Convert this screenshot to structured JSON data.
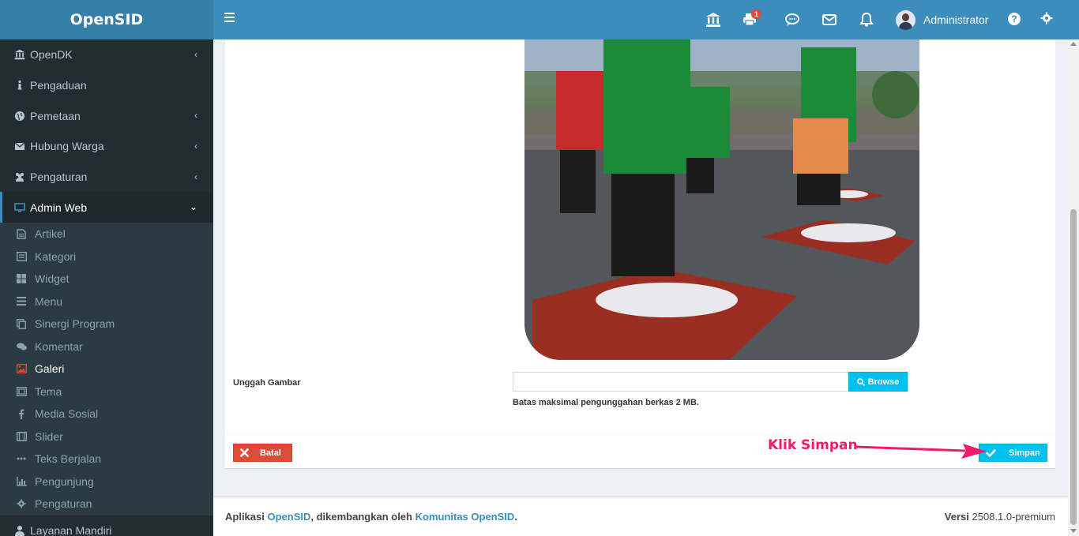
{
  "app": {
    "title": "OpenSID"
  },
  "header": {
    "username": "Administrator",
    "print_badge": "1"
  },
  "sidebar": {
    "items": [
      {
        "label": "OpenDK",
        "icon": "bank-icon",
        "has_children": true
      },
      {
        "label": "Pengaduan",
        "icon": "info-icon",
        "has_children": false
      },
      {
        "label": "Pemetaan",
        "icon": "globe-icon",
        "has_children": true
      },
      {
        "label": "Hubung Warga",
        "icon": "envelope-icon",
        "has_children": true
      },
      {
        "label": "Pengaturan",
        "icon": "users-icon",
        "has_children": true
      },
      {
        "label": "Admin Web",
        "icon": "desktop-icon",
        "has_children": true,
        "expanded": true
      }
    ],
    "submenu": [
      {
        "label": "Artikel",
        "icon": "file-icon"
      },
      {
        "label": "Kategori",
        "icon": "list-alt-icon"
      },
      {
        "label": "Widget",
        "icon": "windows-icon"
      },
      {
        "label": "Menu",
        "icon": "bars-icon"
      },
      {
        "label": "Sinergi Program",
        "icon": "copy-icon"
      },
      {
        "label": "Komentar",
        "icon": "comments-icon"
      },
      {
        "label": "Galeri",
        "icon": "image-icon",
        "active": true
      },
      {
        "label": "Tema",
        "icon": "image-frame-icon"
      },
      {
        "label": "Media Sosial",
        "icon": "facebook-icon"
      },
      {
        "label": "Slider",
        "icon": "film-icon"
      },
      {
        "label": "Teks Berjalan",
        "icon": "ellipsis-icon"
      },
      {
        "label": "Pengunjung",
        "icon": "bar-chart-icon"
      },
      {
        "label": "Pengaturan",
        "icon": "gear-icon"
      }
    ],
    "next_item": "Layanan Mandiri"
  },
  "form": {
    "upload_label": "Unggah Gambar",
    "browse_label": "Browse",
    "help_text": "Batas maksimal pengunggahan berkas 2 MB.",
    "cancel_label": "Batal",
    "save_label": "Simpan"
  },
  "annotation": {
    "text": "Klik Simpan",
    "color": "#f0196c"
  },
  "footer": {
    "prefix": "Aplikasi",
    "app_link": "OpenSID",
    "middle": ", dikembangkan oleh",
    "community_link": "Komunitas OpenSID",
    "suffix": ".",
    "version_label": "Versi",
    "version_value": "2508.1.0-premium"
  },
  "colors": {
    "header": "#3c8dbc",
    "logo_bg": "#367fa9",
    "sidebar": "#222d32",
    "danger": "#dd4b39",
    "info": "#00c0ef"
  }
}
